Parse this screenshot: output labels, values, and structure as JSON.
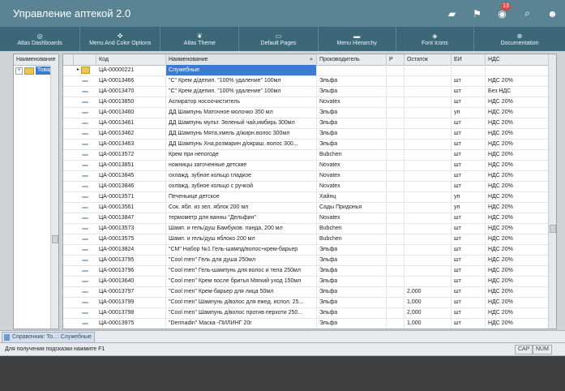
{
  "app": {
    "title": "Управление аптекой 2.0"
  },
  "titlebar": {
    "icons": [
      {
        "name": "briefcase-icon",
        "glyph": "▰",
        "badge": ""
      },
      {
        "name": "flag-icon",
        "glyph": "⚑",
        "badge": ""
      },
      {
        "name": "chat-icon",
        "glyph": "◉",
        "badge": "13"
      },
      {
        "name": "search-icon",
        "glyph": "⌕",
        "badge": ""
      },
      {
        "name": "users-icon",
        "glyph": "☻",
        "badge": ""
      }
    ]
  },
  "ribbon": {
    "items": [
      {
        "label": "Atlas Dashboards",
        "icon": "dashboard-icon",
        "glyph": "◎"
      },
      {
        "label": "Menu And Color Options",
        "icon": "palette-icon",
        "glyph": "✜"
      },
      {
        "label": "Atlas Theme",
        "icon": "leaf-icon",
        "glyph": "❦"
      },
      {
        "label": "Default Pages",
        "icon": "monitor-icon",
        "glyph": "▭"
      },
      {
        "label": "Menu Hierarchy",
        "icon": "folder-icon",
        "glyph": "▬"
      },
      {
        "label": "Font Icons",
        "icon": "font-icon",
        "glyph": "◈"
      },
      {
        "label": "Documentation",
        "icon": "plus-circle-icon",
        "glyph": "⊕"
      }
    ]
  },
  "tree": {
    "header": "Наименование",
    "node": "Товар"
  },
  "grid": {
    "columns": [
      "Код",
      "Наименование",
      "Производитель",
      "Р",
      "Остаток",
      "ЕИ",
      "НДС"
    ],
    "sort_indicator": "▲",
    "rows": [
      {
        "type": "folder",
        "code": "ЦА-00000221",
        "name": "Служебные",
        "maker": "",
        "r": "",
        "stock": "",
        "unit": "",
        "vat": "",
        "selected": true
      },
      {
        "type": "item",
        "code": "ЦА-00013466",
        "name": "\"С\" Крем д/депил. \"100% удаление\" 100мл",
        "maker": "Эльфа",
        "r": "",
        "stock": "",
        "unit": "шт",
        "vat": "НДС 20%",
        "selected": false
      },
      {
        "type": "item",
        "code": "ЦА-00013470",
        "name": "\"С\" Крем д/депил. \"100% удаление\" 100мл",
        "maker": "Эльфа",
        "r": "",
        "stock": "",
        "unit": "шт",
        "vat": "Без НДС",
        "selected": false
      },
      {
        "type": "item",
        "code": "ЦА-00013850",
        "name": "Аспиратор носоочиститель",
        "maker": "Novatex",
        "r": "",
        "stock": "",
        "unit": "шт",
        "vat": "НДС 20%",
        "selected": false
      },
      {
        "type": "item",
        "code": "ЦА-00013460",
        "name": "ДД Шампунь Маточное молочко 350 мл",
        "maker": "Эльфа",
        "r": "",
        "stock": "",
        "unit": "уп",
        "vat": "НДС 20%",
        "selected": false
      },
      {
        "type": "item",
        "code": "ЦА-00013461",
        "name": "ДД Шампунь мульт. Зеленый чай,имбирь 300мл",
        "maker": "Эльфа",
        "r": "",
        "stock": "",
        "unit": "шт",
        "vat": "НДС 20%",
        "selected": false
      },
      {
        "type": "item",
        "code": "ЦА-00013462",
        "name": "ДД Шампунь Мята,хмель д/жирн.волос 300мл",
        "maker": "Эльфа",
        "r": "",
        "stock": "",
        "unit": "шт",
        "vat": "НДС 20%",
        "selected": false
      },
      {
        "type": "item",
        "code": "ЦА-00013463",
        "name": "ДД Шампунь Хна,розмарин д/окраш. волос  300...",
        "maker": "Эльфа",
        "r": "",
        "stock": "",
        "unit": "шт",
        "vat": "НДС 20%",
        "selected": false
      },
      {
        "type": "item",
        "code": "ЦА-00013572",
        "name": "Крем при непогоде",
        "maker": "Bubchen",
        "r": "",
        "stock": "",
        "unit": "шт",
        "vat": "НДС 20%",
        "selected": false
      },
      {
        "type": "item",
        "code": "ЦА-00013851",
        "name": "ножницы заточенные детские",
        "maker": "Novatex",
        "r": "",
        "stock": "",
        "unit": "шт",
        "vat": "НДС 20%",
        "selected": false
      },
      {
        "type": "item",
        "code": "ЦА-00013845",
        "name": "охлажд. зубное кольцо гладкое",
        "maker": "Novatex",
        "r": "",
        "stock": "",
        "unit": "шт",
        "vat": "НДС 20%",
        "selected": false
      },
      {
        "type": "item",
        "code": "ЦА-00013846",
        "name": "охлажд. зубное кольцо с ручкой",
        "maker": "Novatex",
        "r": "",
        "stock": "",
        "unit": "шт",
        "vat": "НДС 20%",
        "selected": false
      },
      {
        "type": "item",
        "code": "ЦА-00013571",
        "name": "Печеньице детское",
        "maker": "Хайнц",
        "r": "",
        "stock": "",
        "unit": "уп",
        "vat": "НДС 20%",
        "selected": false
      },
      {
        "type": "item",
        "code": "ЦА-00013561",
        "name": "Сок. ябл. из зел. яблок 200 мл",
        "maker": "Сады Придонья",
        "r": "",
        "stock": "",
        "unit": "уп",
        "vat": "НДС 20%",
        "selected": false
      },
      {
        "type": "item",
        "code": "ЦА-00013847",
        "name": "термометр для ванны \"Дельфин\"",
        "maker": "Novatex",
        "r": "",
        "stock": "",
        "unit": "шт",
        "vat": "НДС 20%",
        "selected": false
      },
      {
        "type": "item",
        "code": "ЦА-00013573",
        "name": "Шамп. и гель/душ Бамбуков. панда, 200 мл",
        "maker": "Bubchen",
        "r": "",
        "stock": "",
        "unit": "шт",
        "vat": "НДС 20%",
        "selected": false
      },
      {
        "type": "item",
        "code": "ЦА-00013575",
        "name": "Шамп. и гель/душ яблоко 200 мл",
        "maker": "Bubchen",
        "r": "",
        "stock": "",
        "unit": "шт",
        "vat": "НДС 20%",
        "selected": false
      },
      {
        "type": "item",
        "code": "ЦА-00013824",
        "name": "\"CM\" Набор №1 Гель-шампд/волос+крем-барьер",
        "maker": "Эльфа",
        "r": "",
        "stock": "",
        "unit": "шт",
        "vat": "НДС 20%",
        "selected": false
      },
      {
        "type": "item",
        "code": "ЦА-00013795",
        "name": "\"Cool men\" Гель для душа 250мл",
        "maker": "Эльфа",
        "r": "",
        "stock": "",
        "unit": "шт",
        "vat": "НДС 20%",
        "selected": false
      },
      {
        "type": "item",
        "code": "ЦА-00013796",
        "name": "\"Cool men\" Гель-шампунь для волос и тела 250мл",
        "maker": "Эльфа",
        "r": "",
        "stock": "",
        "unit": "шт",
        "vat": "НДС 20%",
        "selected": false
      },
      {
        "type": "item",
        "code": "ЦА-00013640",
        "name": "\"Cool men\" Крем после бритья Мягкий уход 150мл",
        "maker": "Эльфа",
        "r": "",
        "stock": "",
        "unit": "шт",
        "vat": "НДС 20%",
        "selected": false
      },
      {
        "type": "item",
        "code": "ЦА-00013797",
        "name": "\"Cool men\" Крем-барьер для лица 50мл",
        "maker": "Эльфа",
        "r": "",
        "stock": "2,000",
        "unit": "шт",
        "vat": "НДС 20%",
        "selected": false
      },
      {
        "type": "item",
        "code": "ЦА-00013799",
        "name": "\"Cool men\" Шампунь д/волос для ежед. испол. 25...",
        "maker": "Эльфа",
        "r": "",
        "stock": "1,000",
        "unit": "шт",
        "vat": "НДС 20%",
        "selected": false
      },
      {
        "type": "item",
        "code": "ЦА-00013798",
        "name": "\"Cool men\" Шампунь д/волос против перхоти 250...",
        "maker": "Эльфа",
        "r": "",
        "stock": "2,000",
        "unit": "шт",
        "vat": "НДС 20%",
        "selected": false
      },
      {
        "type": "item",
        "code": "ЦА-00013975",
        "name": "\"Dermadin\" Маска -ПИЛИНГ 20г",
        "maker": "Эльфа",
        "r": "",
        "stock": "1,000",
        "unit": "шт",
        "vat": "НДС 20%",
        "selected": false
      }
    ]
  },
  "navtab": {
    "label": "Справочник: То...: Служебные"
  },
  "status": {
    "hint": "Для получения подсказки нажмите F1",
    "cap": "CAP",
    "num": "NUM"
  }
}
